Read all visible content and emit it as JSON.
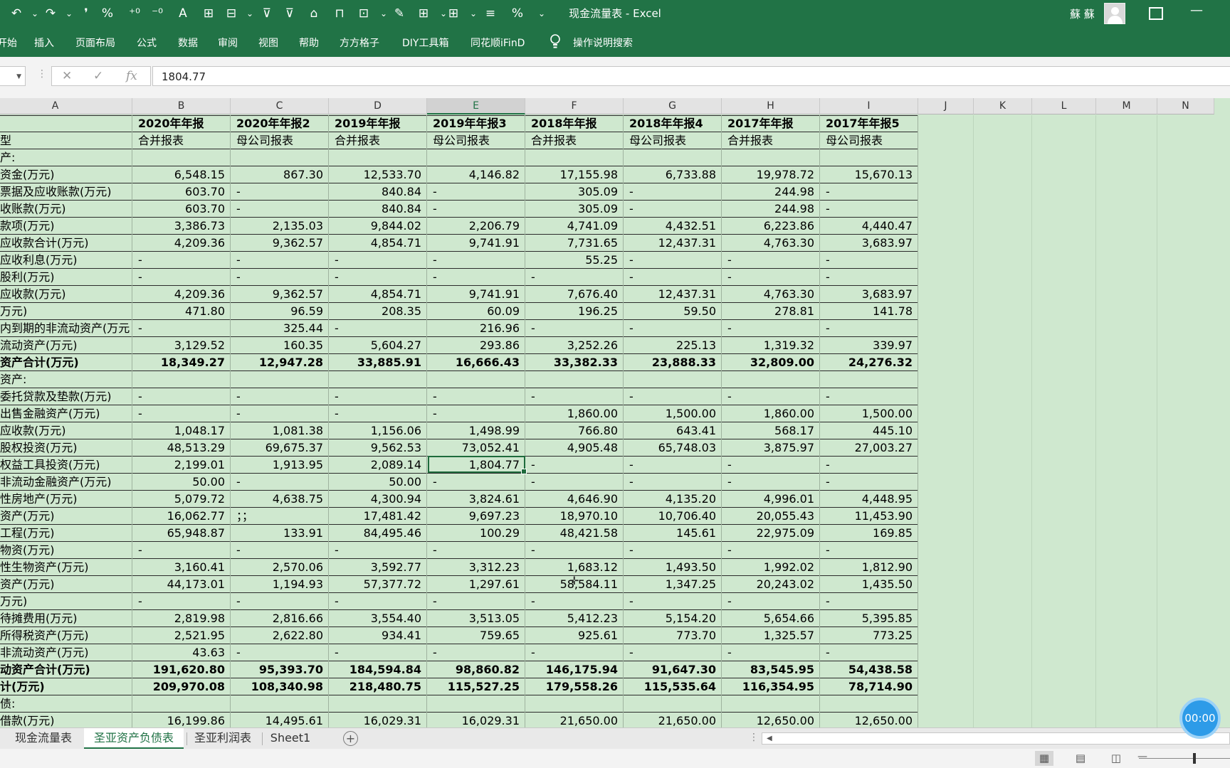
{
  "titlebar": {
    "title": "现金流量表 - Excel",
    "user": "蘇 蘇",
    "quick_access": [
      "↶",
      "⌄",
      "↷",
      "⌄",
      "❜",
      "%",
      "⁺⁰",
      "⁻⁰",
      "A",
      "⊞",
      "⊟",
      "⌄",
      "⊽",
      "⊽",
      "⌂",
      "⊓",
      "⊡",
      "⌄",
      "✎",
      "⊞",
      "⌄",
      "⊞",
      "⌄",
      "≡",
      "%",
      "⌄"
    ],
    "ribbon_display_icon": "ribbon-display-icon",
    "minimize_label": "—"
  },
  "ribbon": {
    "tabs": [
      "开始",
      "插入",
      "页面布局",
      "公式",
      "数据",
      "审阅",
      "视图",
      "帮助",
      "方方格子",
      "DIY工具箱",
      "同花顺iFinD",
      "操作说明搜索"
    ]
  },
  "formula_bar": {
    "value": "1804.77",
    "cancel": "✕",
    "enter": "✓",
    "fx": "fx"
  },
  "columns": [
    "A",
    "B",
    "C",
    "D",
    "E",
    "F",
    "G",
    "H",
    "I",
    "J",
    "K",
    "L",
    "M",
    "N"
  ],
  "header_rows": [
    {
      "label": "",
      "values": [
        "2020年年报",
        "2020年年报2",
        "2019年年报",
        "2019年年报3",
        "2018年年报",
        "2018年年报4",
        "2017年年报",
        "2017年年报5"
      ],
      "bold": true
    },
    {
      "label": "型",
      "values": [
        "合并报表",
        "母公司报表",
        "合并报表",
        "母公司报表",
        "合并报表",
        "母公司报表",
        "合并报表",
        "母公司报表"
      ],
      "bold": false
    }
  ],
  "rows": [
    {
      "label": "产:",
      "values": [
        "",
        "",
        "",
        "",
        "",
        "",
        "",
        ""
      ]
    },
    {
      "label": "资金(万元)",
      "values": [
        "6,548.15",
        "867.30",
        "12,533.70",
        "4,146.82",
        "17,155.98",
        "6,733.88",
        "19,978.72",
        "15,670.13"
      ]
    },
    {
      "label": "票据及应收账款(万元)",
      "values": [
        "603.70",
        "-",
        "840.84",
        "-",
        "305.09",
        "-",
        "244.98",
        "-"
      ]
    },
    {
      "label": "收账款(万元)",
      "values": [
        "603.70",
        "-",
        "840.84",
        "-",
        "305.09",
        "-",
        "244.98",
        "-"
      ]
    },
    {
      "label": "款项(万元)",
      "values": [
        "3,386.73",
        "2,135.03",
        "9,844.02",
        "2,206.79",
        "4,741.09",
        "4,432.51",
        "6,223.86",
        "4,440.47"
      ]
    },
    {
      "label": "应收款合计(万元)",
      "values": [
        "4,209.36",
        "9,362.57",
        "4,854.71",
        "9,741.91",
        "7,731.65",
        "12,437.31",
        "4,763.30",
        "3,683.97"
      ]
    },
    {
      "label": "应收利息(万元)",
      "values": [
        "-",
        "-",
        "-",
        "-",
        "55.25",
        "-",
        "-",
        "-"
      ]
    },
    {
      "label": "股利(万元)",
      "values": [
        "-",
        "-",
        "-",
        "-",
        "-",
        "-",
        "-",
        "-"
      ]
    },
    {
      "label": "应收款(万元)",
      "values": [
        "4,209.36",
        "9,362.57",
        "4,854.71",
        "9,741.91",
        "7,676.40",
        "12,437.31",
        "4,763.30",
        "3,683.97"
      ]
    },
    {
      "label": "万元)",
      "values": [
        "471.80",
        "96.59",
        "208.35",
        "60.09",
        "196.25",
        "59.50",
        "278.81",
        "141.78"
      ]
    },
    {
      "label": "内到期的非流动资产(万元",
      "values": [
        "-",
        "325.44",
        "-",
        "216.96",
        "-",
        "-",
        "-",
        "-"
      ]
    },
    {
      "label": "流动资产(万元)",
      "values": [
        "3,129.52",
        "160.35",
        "5,604.27",
        "293.86",
        "3,252.26",
        "225.13",
        "1,319.32",
        "339.97"
      ]
    },
    {
      "label": "资产合计(万元)",
      "values": [
        "18,349.27",
        "12,947.28",
        "33,885.91",
        "16,666.43",
        "33,382.33",
        "23,888.33",
        "32,809.00",
        "24,276.32"
      ],
      "bold": true
    },
    {
      "label": "资产:",
      "values": [
        "",
        "",
        "",
        "",
        "",
        "",
        "",
        ""
      ]
    },
    {
      "label": "委托贷款及垫款(万元)",
      "values": [
        "-",
        "-",
        "-",
        "-",
        "-",
        "-",
        "-",
        "-"
      ]
    },
    {
      "label": "出售金融资产(万元)",
      "values": [
        "-",
        "-",
        "-",
        "-",
        "1,860.00",
        "1,500.00",
        "1,860.00",
        "1,500.00"
      ]
    },
    {
      "label": "应收款(万元)",
      "values": [
        "1,048.17",
        "1,081.38",
        "1,156.06",
        "1,498.99",
        "766.80",
        "643.41",
        "568.17",
        "445.10"
      ]
    },
    {
      "label": "股权投资(万元)",
      "values": [
        "48,513.29",
        "69,675.37",
        "9,562.53",
        "73,052.41",
        "4,905.48",
        "65,748.03",
        "3,875.97",
        "27,003.27"
      ]
    },
    {
      "label": "权益工具投资(万元)",
      "values": [
        "2,199.01",
        "1,913.95",
        "2,089.14",
        "1,804.77",
        "-",
        "-",
        "-",
        "-"
      ]
    },
    {
      "label": "非流动金融资产(万元)",
      "values": [
        "50.00",
        "-",
        "50.00",
        "-",
        "-",
        "-",
        "-",
        "-"
      ]
    },
    {
      "label": "性房地产(万元)",
      "values": [
        "5,079.72",
        "4,638.75",
        "4,300.94",
        "3,824.61",
        "4,646.90",
        "4,135.20",
        "4,996.01",
        "4,448.95"
      ]
    },
    {
      "label": "资产(万元)",
      "values": [
        "16,062.77",
        "；；",
        "17,481.42",
        "9,697.23",
        "18,970.10",
        "10,706.40",
        "20,055.43",
        "11,453.90"
      ]
    },
    {
      "label": "工程(万元)",
      "values": [
        "65,948.87",
        "133.91",
        "84,495.46",
        "100.29",
        "48,421.58",
        "145.61",
        "22,975.09",
        "169.85"
      ]
    },
    {
      "label": "物资(万元)",
      "values": [
        "-",
        "-",
        "-",
        "-",
        "-",
        "-",
        "-",
        "-"
      ]
    },
    {
      "label": "性生物资产(万元)",
      "values": [
        "3,160.41",
        "2,570.06",
        "3,592.77",
        "3,312.23",
        "1,683.12",
        "1,493.50",
        "1,992.02",
        "1,812.90"
      ]
    },
    {
      "label": "资产(万元)",
      "values": [
        "44,173.01",
        "1,194.93",
        "57,377.72",
        "1,297.61",
        "58,584.11",
        "1,347.25",
        "20,243.02",
        "1,435.50"
      ]
    },
    {
      "label": "万元)",
      "values": [
        "-",
        "-",
        "-",
        "-",
        "-",
        "-",
        "-",
        "-"
      ]
    },
    {
      "label": "待摊费用(万元)",
      "values": [
        "2,819.98",
        "2,816.66",
        "3,554.40",
        "3,513.05",
        "5,412.23",
        "5,154.20",
        "5,654.66",
        "5,395.85"
      ]
    },
    {
      "label": "所得税资产(万元)",
      "values": [
        "2,521.95",
        "2,622.80",
        "934.41",
        "759.65",
        "925.61",
        "773.70",
        "1,325.57",
        "773.25"
      ]
    },
    {
      "label": "非流动资产(万元)",
      "values": [
        "43.63",
        "-",
        "-",
        "-",
        "-",
        "-",
        "-",
        "-"
      ]
    },
    {
      "label": "动资产合计(万元)",
      "values": [
        "191,620.80",
        "95,393.70",
        "184,594.84",
        "98,860.82",
        "146,175.94",
        "91,647.30",
        "83,545.95",
        "54,438.58"
      ],
      "bold": true
    },
    {
      "label": "计(万元)",
      "values": [
        "209,970.08",
        "108,340.98",
        "218,480.75",
        "115,527.25",
        "179,558.26",
        "115,535.64",
        "116,354.95",
        "78,714.90"
      ],
      "bold": true
    },
    {
      "label": "债:",
      "values": [
        "",
        "",
        "",
        "",
        "",
        "",
        "",
        ""
      ]
    },
    {
      "label": "借款(万元)",
      "values": [
        "16,199.86",
        "14,495.61",
        "16,029.31",
        "16,029.31",
        "21,650.00",
        "21,650.00",
        "12,650.00",
        "12,650.00"
      ]
    }
  ],
  "sheets": [
    {
      "label": "现金流量表",
      "active": false
    },
    {
      "label": "圣亚资产负债表",
      "active": true
    },
    {
      "label": "圣亚利润表",
      "active": false
    },
    {
      "label": "Sheet1",
      "active": false
    }
  ],
  "add_sheet": "+",
  "timer": "00:00"
}
